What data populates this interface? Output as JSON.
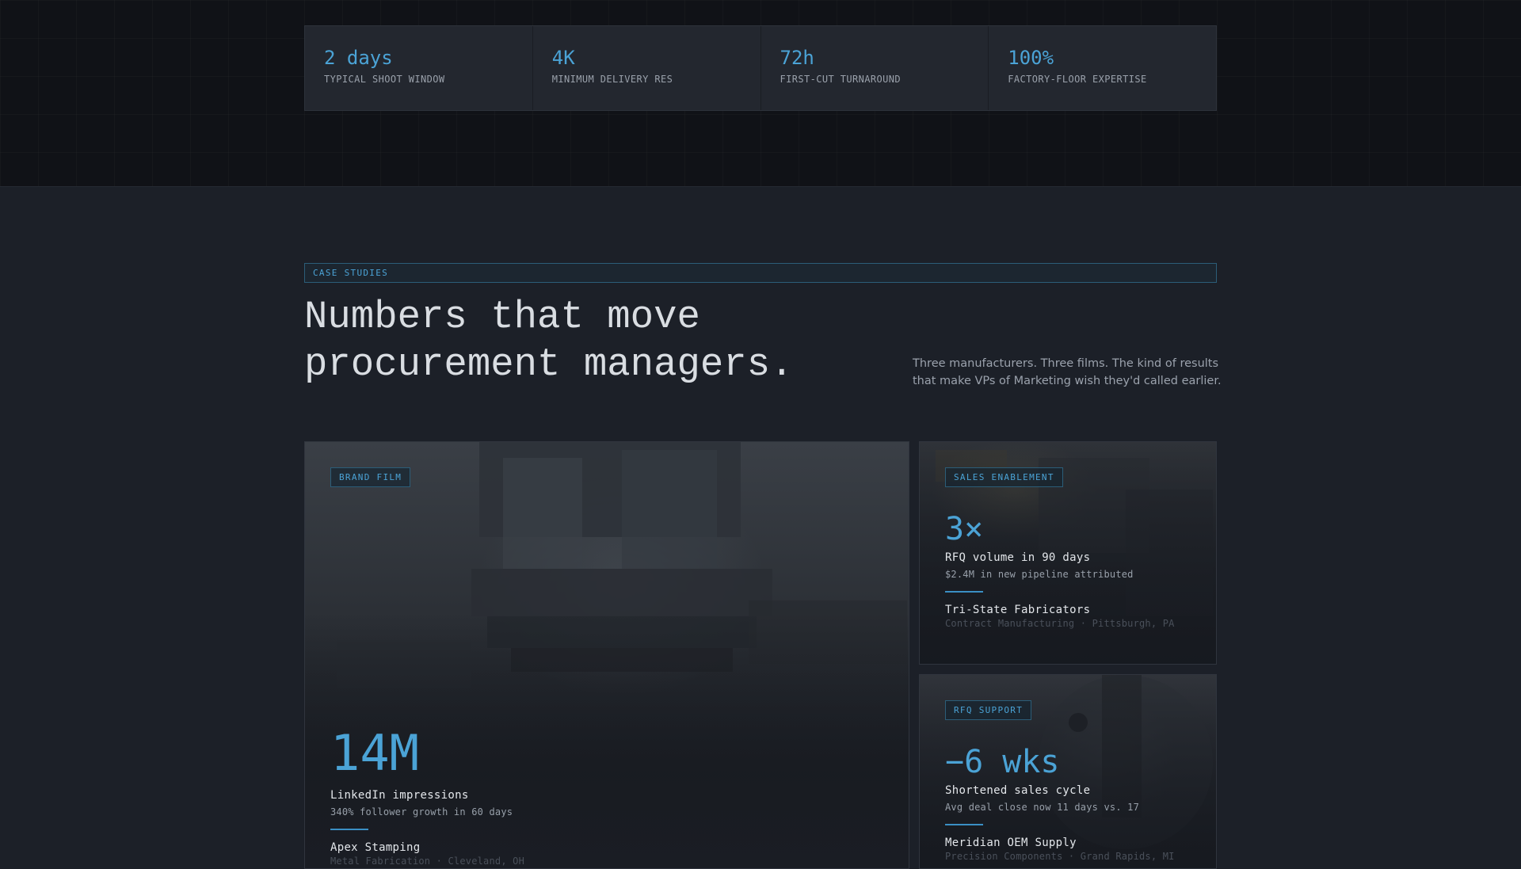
{
  "stats": [
    {
      "value": "2 days",
      "label": "TYPICAL SHOOT WINDOW"
    },
    {
      "value": "4K",
      "label": "MINIMUM DELIVERY RES"
    },
    {
      "value": "72h",
      "label": "FIRST-CUT TURNAROUND"
    },
    {
      "value": "100%",
      "label": "FACTORY-FLOOR EXPERTISE"
    }
  ],
  "case_studies": {
    "tag": "CASE STUDIES",
    "headline_line1": "Numbers that move",
    "headline_line2": "procurement managers.",
    "intro": "Three manufacturers. Three films. The kind of results that make VPs of Marketing wish they'd called earlier."
  },
  "cards": [
    {
      "badge": "BRAND FILM",
      "metric": "14M",
      "title": "LinkedIn impressions",
      "subtitle": "340% follower growth in 60 days",
      "client": "Apex Stamping",
      "client_meta": "Metal Fabrication · Cleveland, OH"
    },
    {
      "badge": "SALES ENABLEMENT",
      "metric": "3×",
      "title": "RFQ volume in 90 days",
      "subtitle": "$2.4M in new pipeline attributed",
      "client": "Tri-State Fabricators",
      "client_meta": "Contract Manufacturing · Pittsburgh, PA"
    },
    {
      "badge": "RFQ SUPPORT",
      "metric": "−6 wks",
      "title": "Shortened sales cycle",
      "subtitle": "Avg deal close now 11 days vs. 17",
      "client": "Meridian OEM Supply",
      "client_meta": "Precision Components · Grand Rapids, MI"
    }
  ],
  "colors": {
    "accent": "#4ba3d6",
    "background": "#1c2028",
    "band": "#101217"
  }
}
